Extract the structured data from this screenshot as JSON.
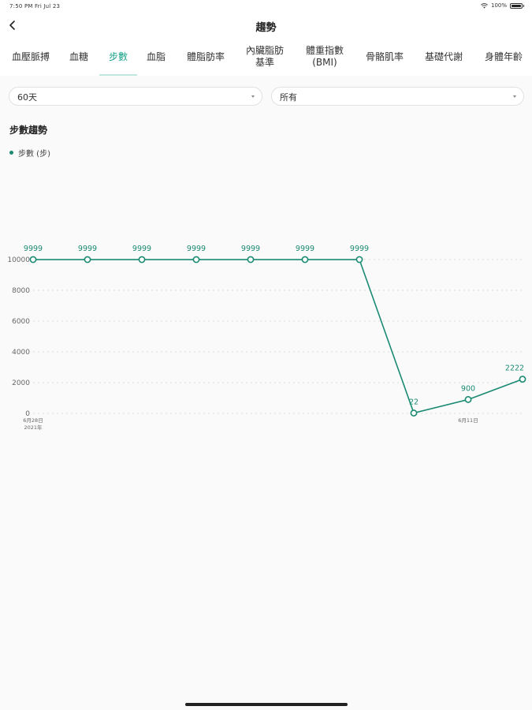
{
  "status_bar": {
    "time": "7:50 PM  Fri Jul 23",
    "battery": "100%"
  },
  "nav": {
    "title": "趨勢"
  },
  "tabs": [
    {
      "lines": [
        "血壓脈搏"
      ],
      "active": false
    },
    {
      "lines": [
        "血糖"
      ],
      "active": false
    },
    {
      "lines": [
        "步數"
      ],
      "active": true
    },
    {
      "lines": [
        "血脂"
      ],
      "active": false
    },
    {
      "lines": [
        "體脂肪率"
      ],
      "active": false
    },
    {
      "lines": [
        "內臟脂肪",
        "基準"
      ],
      "active": false
    },
    {
      "lines": [
        "體重指數",
        "(BMI)"
      ],
      "active": false
    },
    {
      "lines": [
        "骨骼肌率"
      ],
      "active": false
    },
    {
      "lines": [
        "基礎代謝"
      ],
      "active": false
    },
    {
      "lines": [
        "身體年齡"
      ],
      "active": false
    }
  ],
  "filters": {
    "range": "60天",
    "scope": "所有"
  },
  "colors": {
    "accent": "#1aa38a",
    "series": "#1a8a72",
    "tab_underline": "#bfe7dd"
  },
  "chart": {
    "title": "步數趨勢",
    "legend_label": "步數 (步)"
  },
  "chart_data": {
    "type": "line",
    "ylim": [
      0,
      10000
    ],
    "yticks": [
      0,
      2000,
      4000,
      6000,
      8000,
      10000
    ],
    "x_tick_labels": [
      {
        "index": 0,
        "lines": [
          "6月28日",
          "2021年"
        ]
      },
      {
        "index": 8,
        "lines": [
          "6月11日"
        ]
      }
    ],
    "grid": true,
    "series": [
      {
        "name": "步數 (步)",
        "values": [
          9999,
          9999,
          9999,
          9999,
          9999,
          9999,
          9999,
          22,
          900,
          2222
        ]
      }
    ]
  }
}
